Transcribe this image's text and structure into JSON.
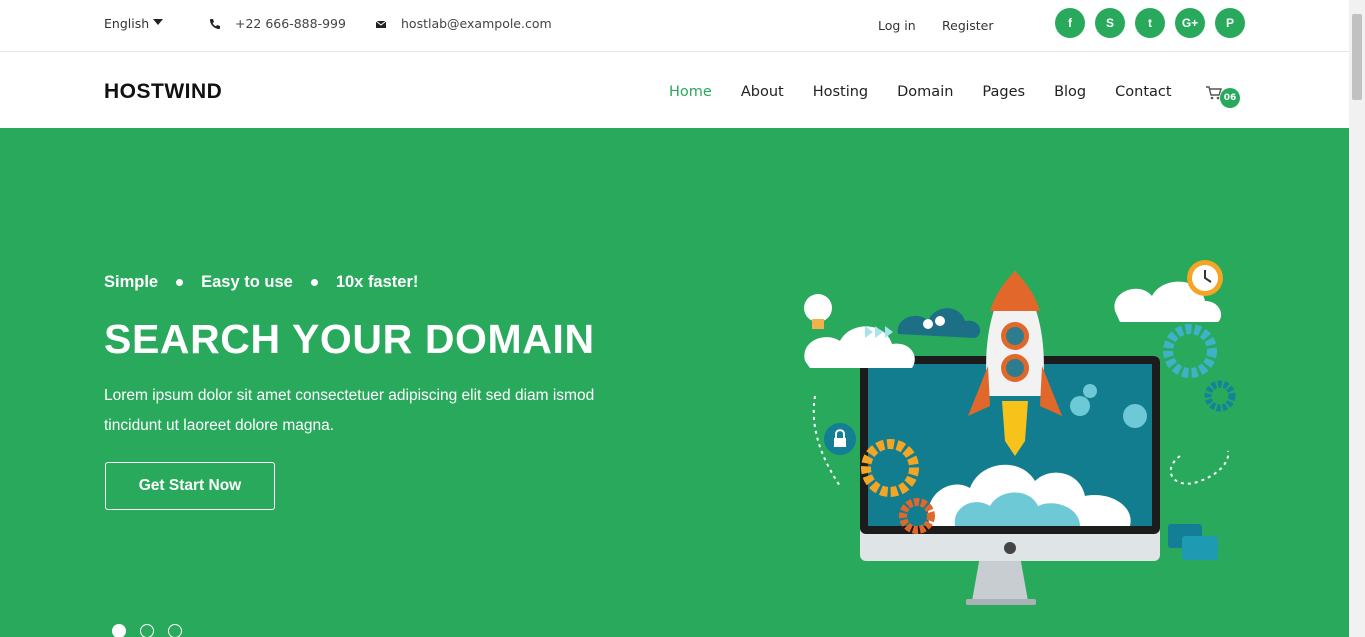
{
  "topbar": {
    "language": "English",
    "phone": "+22 666-888-999",
    "email": "hostlab@exampole.com",
    "login": "Log in",
    "register": "Register",
    "socials": [
      {
        "icon": "facebook-icon",
        "glyph": "f"
      },
      {
        "icon": "skype-icon",
        "glyph": "S"
      },
      {
        "icon": "twitter-icon",
        "glyph": "t"
      },
      {
        "icon": "google-plus-icon",
        "glyph": "G+"
      },
      {
        "icon": "pinterest-icon",
        "glyph": "P"
      }
    ]
  },
  "header": {
    "logo": "HOSTWIND",
    "nav": [
      "Home",
      "About",
      "Hosting",
      "Domain",
      "Pages",
      "Blog",
      "Contact"
    ],
    "active_nav": "Home",
    "cart_count": "06"
  },
  "hero": {
    "tagline": [
      "Simple",
      "Easy to use",
      "10x faster!"
    ],
    "title": "SEARCH YOUR DOMAIN",
    "description": "Lorem ipsum dolor sit amet consectetuer adipiscing elit sed diam ismod tincidunt ut laoreet dolore magna.",
    "cta": "Get Start Now",
    "slides": 3,
    "active_slide": 1
  },
  "colors": {
    "brand_green": "#28a95c",
    "white": "#ffffff"
  }
}
